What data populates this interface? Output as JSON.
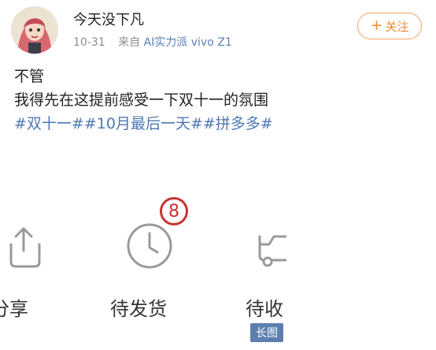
{
  "post": {
    "username": "今天没下凡",
    "date": "10-31",
    "source_prefix": "来自",
    "source": "AI实力派 vivo Z1",
    "follow_label": "关注",
    "text_lines": [
      "不管",
      "我得先在这提前感受一下双十一的氛围"
    ],
    "hashtags": [
      "#双十一#",
      "#10月最后一天#",
      "#拼多多#"
    ]
  },
  "embedded_screenshot": {
    "items": [
      {
        "label": "分享",
        "icon": "share-box-icon"
      },
      {
        "label": "待发货",
        "icon": "clock-icon"
      },
      {
        "label": "待收",
        "icon": "truck-icon"
      }
    ],
    "badge_count": "8",
    "long_image_tag": "长图"
  },
  "colors": {
    "link": "#4d79b4",
    "follow": "#f08a2e",
    "badge": "#c8322f",
    "tag_bg": "#5e7fae"
  }
}
